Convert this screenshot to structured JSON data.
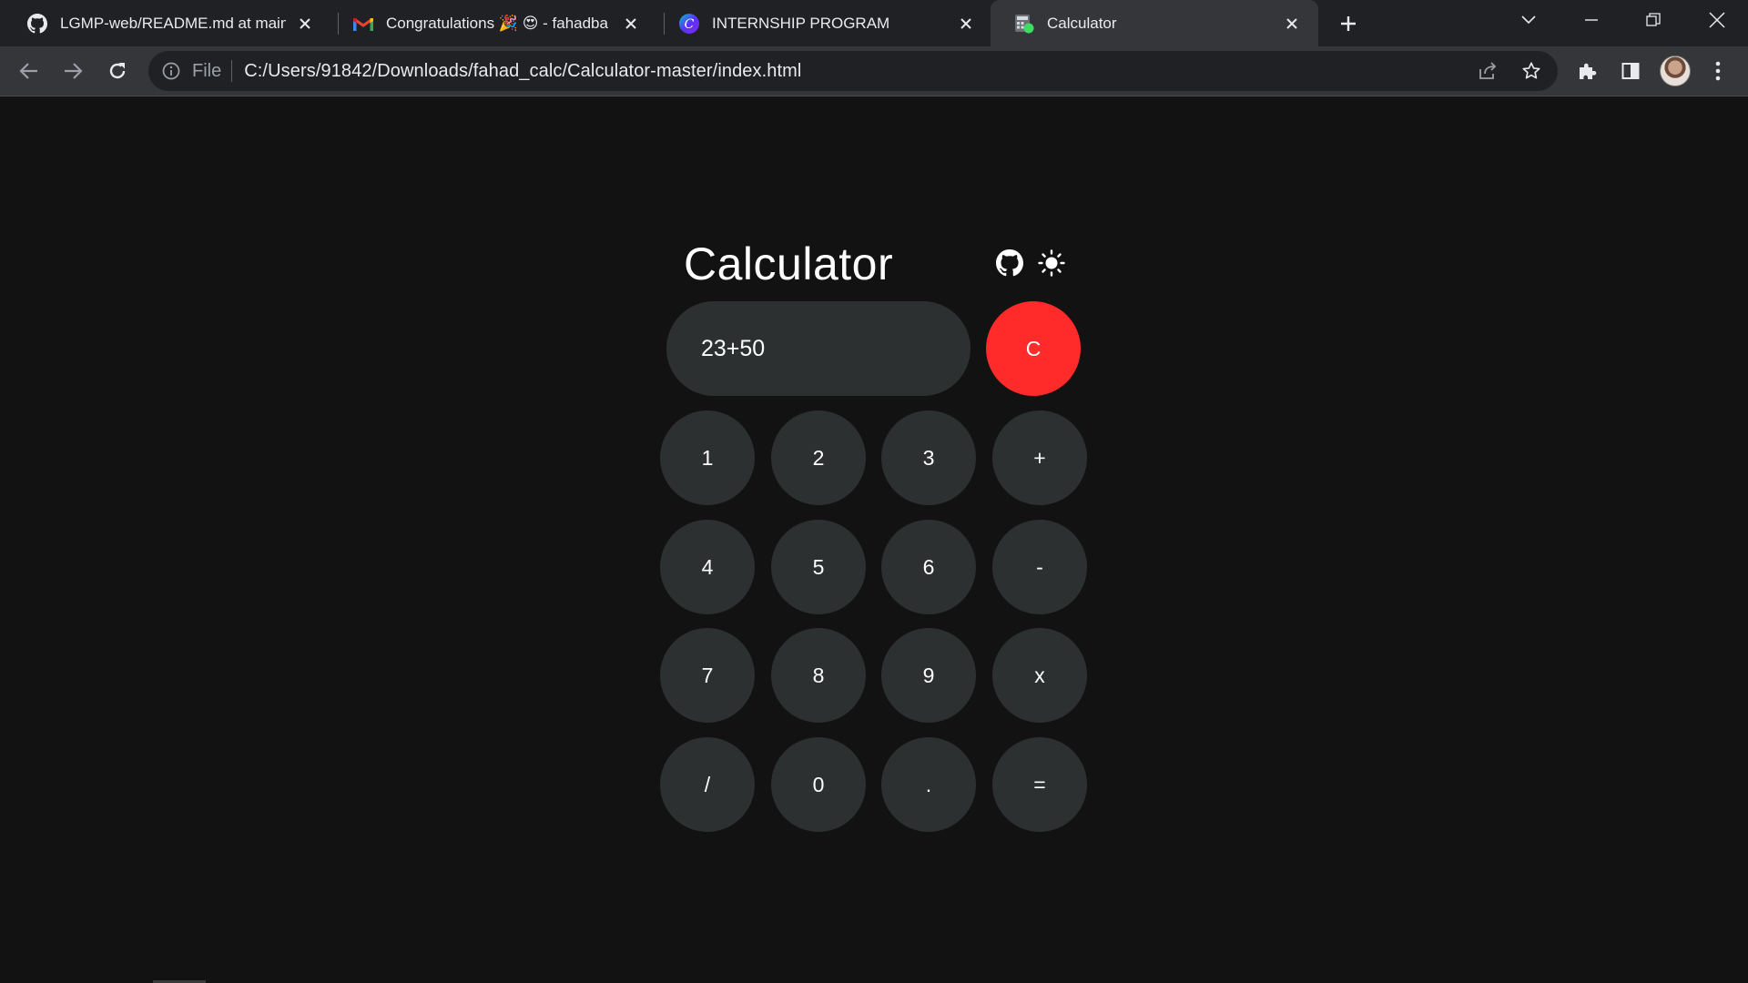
{
  "browser": {
    "tabs": [
      {
        "title": "LGMP-web/README.md at main",
        "icon": "github-icon"
      },
      {
        "title": "Congratulations 🎉 😍 - fahadba",
        "icon": "gmail-icon"
      },
      {
        "title": "INTERNSHIP PROGRAM",
        "icon": "canva-icon"
      },
      {
        "title": "Calculator",
        "icon": "calculator-icon",
        "active": true
      }
    ],
    "address_bar": {
      "scheme_label": "File",
      "url": "C:/Users/91842/Downloads/fahad_calc/Calculator-master/index.html"
    }
  },
  "app": {
    "title": "Calculator",
    "display_value": "23+50",
    "clear_label": "C",
    "keys": [
      [
        "1",
        "2",
        "3",
        "+"
      ],
      [
        "4",
        "5",
        "6",
        "-"
      ],
      [
        "7",
        "8",
        "9",
        "x"
      ],
      [
        "/",
        "0",
        ".",
        "="
      ]
    ],
    "colors": {
      "background": "#121212",
      "key": "#2d3030",
      "clear": "#ff2a2a",
      "text": "#ffffff"
    }
  }
}
